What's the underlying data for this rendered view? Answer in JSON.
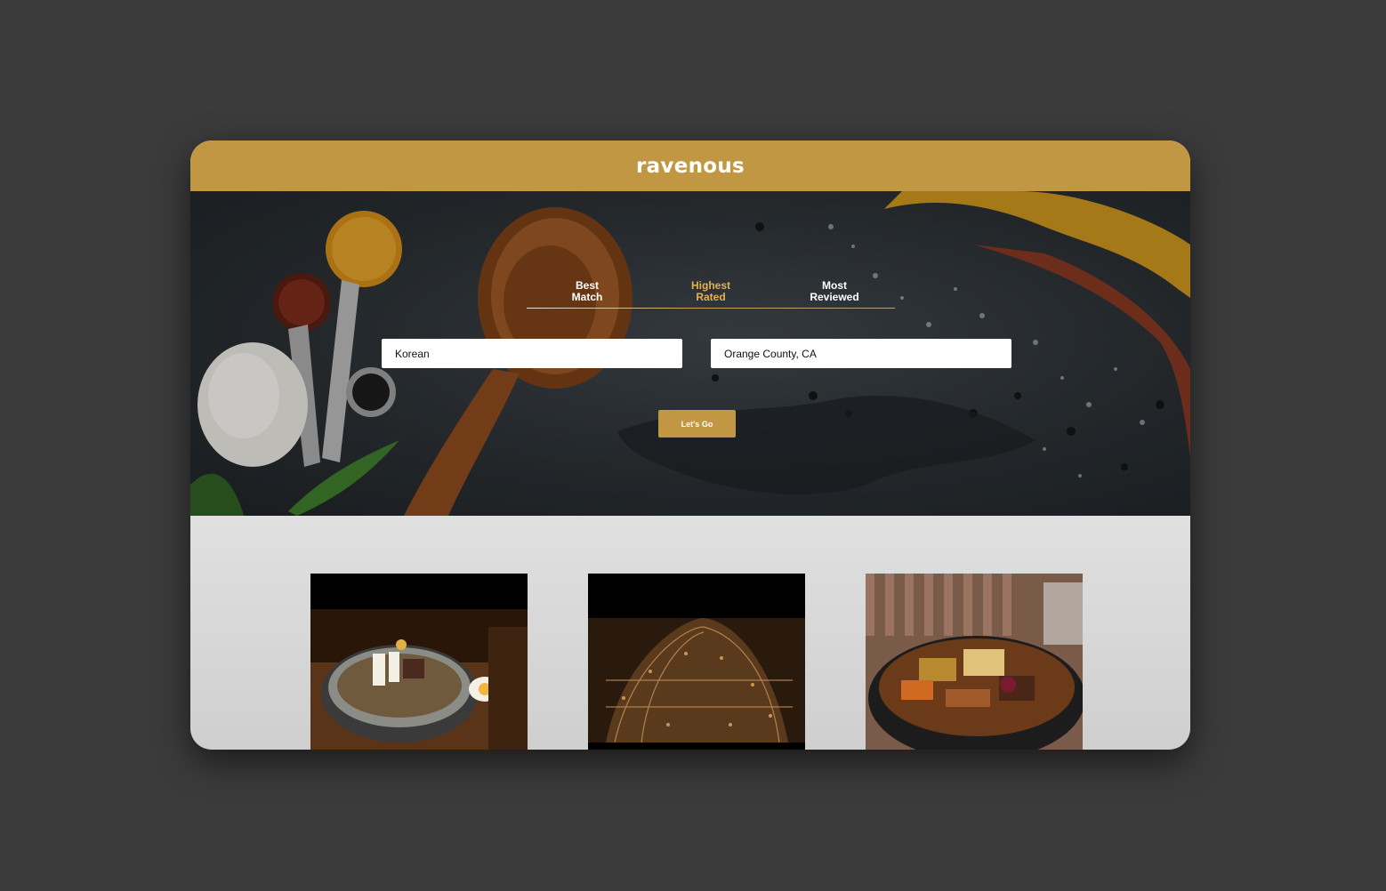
{
  "header": {
    "logo": "ravenous"
  },
  "sort_options": [
    {
      "line1": "Best",
      "line2": "Match",
      "active": false
    },
    {
      "line1": "Highest",
      "line2": "Rated",
      "active": true
    },
    {
      "line1": "Most",
      "line2": "Reviewed",
      "active": false
    }
  ],
  "search": {
    "term_value": "Korean",
    "location_value": "Orange County, CA",
    "submit_label": "Let's Go"
  },
  "results": [
    {
      "image": "cold-noodle-soup-photo"
    },
    {
      "image": "restaurant-sign-photo"
    },
    {
      "image": "braised-short-rib-stew-photo"
    }
  ],
  "colors": {
    "brand_gold": "#c29743",
    "active_tab": "#e2b24f",
    "page_bg": "#3b3b3b"
  }
}
